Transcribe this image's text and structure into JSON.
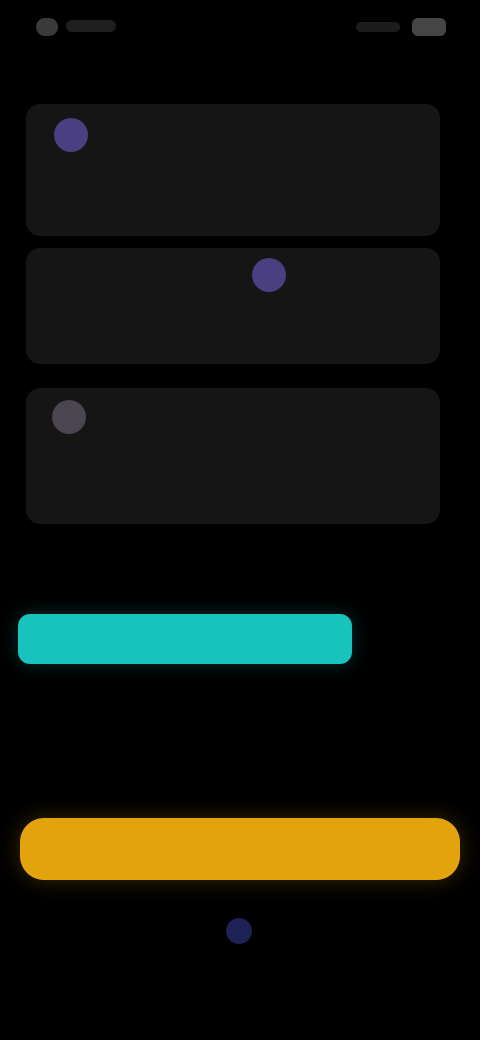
{
  "status_bar": {},
  "cards": [
    {
      "username": "",
      "body": "",
      "avatar_color": "#4a3f80"
    },
    {
      "username": "",
      "body": "",
      "avatar_color": "#4a3f80"
    },
    {
      "username": "",
      "body": "",
      "avatar_color": "#4a4550"
    }
  ],
  "section": {
    "title": "",
    "description": ""
  },
  "primary_button": {
    "label": ""
  },
  "colors": {
    "background": "#000000",
    "card": "#151515",
    "cta_teal": "#18c3bd",
    "accent_yellow": "#e3a30d",
    "indicator": "#1d2155"
  }
}
